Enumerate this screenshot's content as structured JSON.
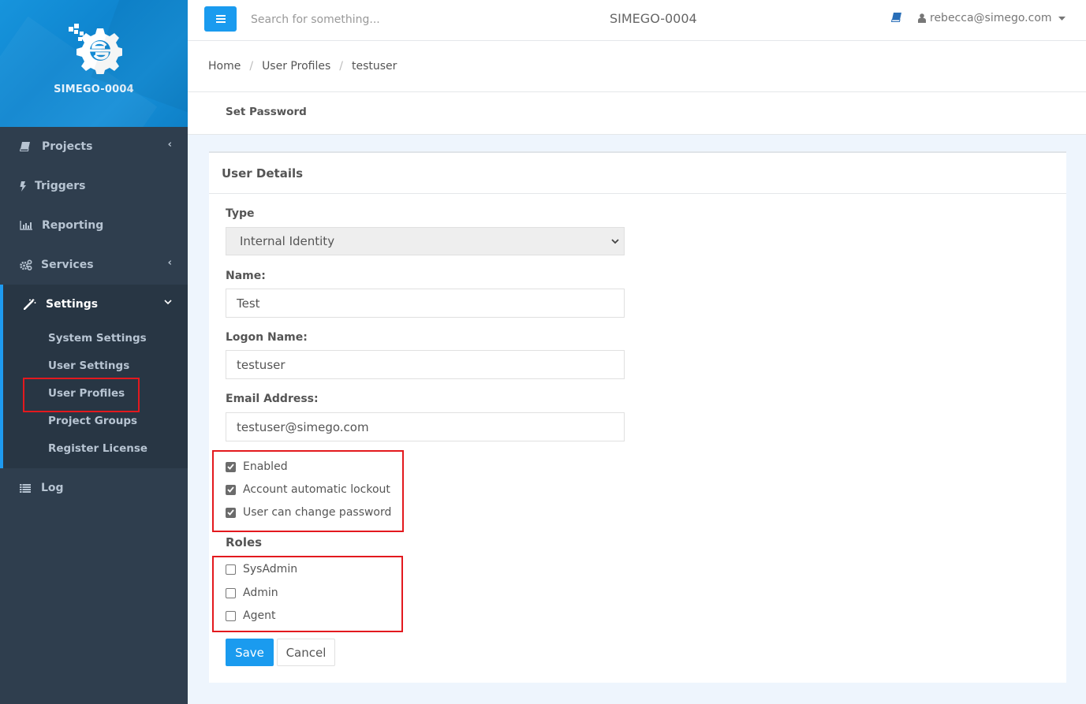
{
  "brand": {
    "name": "SIMEGO-0004",
    "logo_icon": "simego-gear-logo"
  },
  "sidebar": {
    "items": [
      {
        "label": "Projects",
        "icon": "book-icon",
        "has_caret": true
      },
      {
        "label": "Triggers",
        "icon": "bolt-icon",
        "has_caret": false
      },
      {
        "label": "Reporting",
        "icon": "bar-chart-icon",
        "has_caret": false
      },
      {
        "label": "Services",
        "icon": "cogs-icon",
        "has_caret": true
      },
      {
        "label": "Settings",
        "icon": "magic-wand-icon",
        "expanded": true,
        "children": [
          {
            "label": "System Settings"
          },
          {
            "label": "User Settings"
          },
          {
            "label": "User Profiles",
            "highlighted": true
          },
          {
            "label": "Project Groups"
          },
          {
            "label": "Register License"
          }
        ]
      },
      {
        "label": "Log",
        "icon": "list-icon",
        "has_caret": false
      }
    ]
  },
  "topbar": {
    "menu_icon": "hamburger-icon",
    "search_placeholder": "Search for something...",
    "title": "SIMEGO-0004",
    "docs_icon": "book-icon",
    "user_email": "rebecca@simego.com"
  },
  "breadcrumb": [
    "Home",
    "User Profiles",
    "testuser"
  ],
  "actions": {
    "set_password": "Set Password"
  },
  "card": {
    "title": "User Details",
    "type_label": "Type",
    "type_value": "Internal Identity",
    "name_label": "Name:",
    "name_value": "Test",
    "logon_label": "Logon Name:",
    "logon_value": "testuser",
    "email_label": "Email Address:",
    "email_value": "testuser@simego.com",
    "options": [
      {
        "label": "Enabled",
        "checked": true
      },
      {
        "label": "Account automatic lockout",
        "checked": true
      },
      {
        "label": "User can change password",
        "checked": true
      }
    ],
    "roles_title": "Roles",
    "roles": [
      {
        "label": "SysAdmin",
        "checked": false
      },
      {
        "label": "Admin",
        "checked": false
      },
      {
        "label": "Agent",
        "checked": false
      }
    ],
    "save_label": "Save",
    "cancel_label": "Cancel"
  },
  "colors": {
    "accent": "#1a9bef",
    "sidebar_bg": "#2f3e4e",
    "annotation_red": "#e3191e",
    "page_bg": "#eef5fd"
  }
}
